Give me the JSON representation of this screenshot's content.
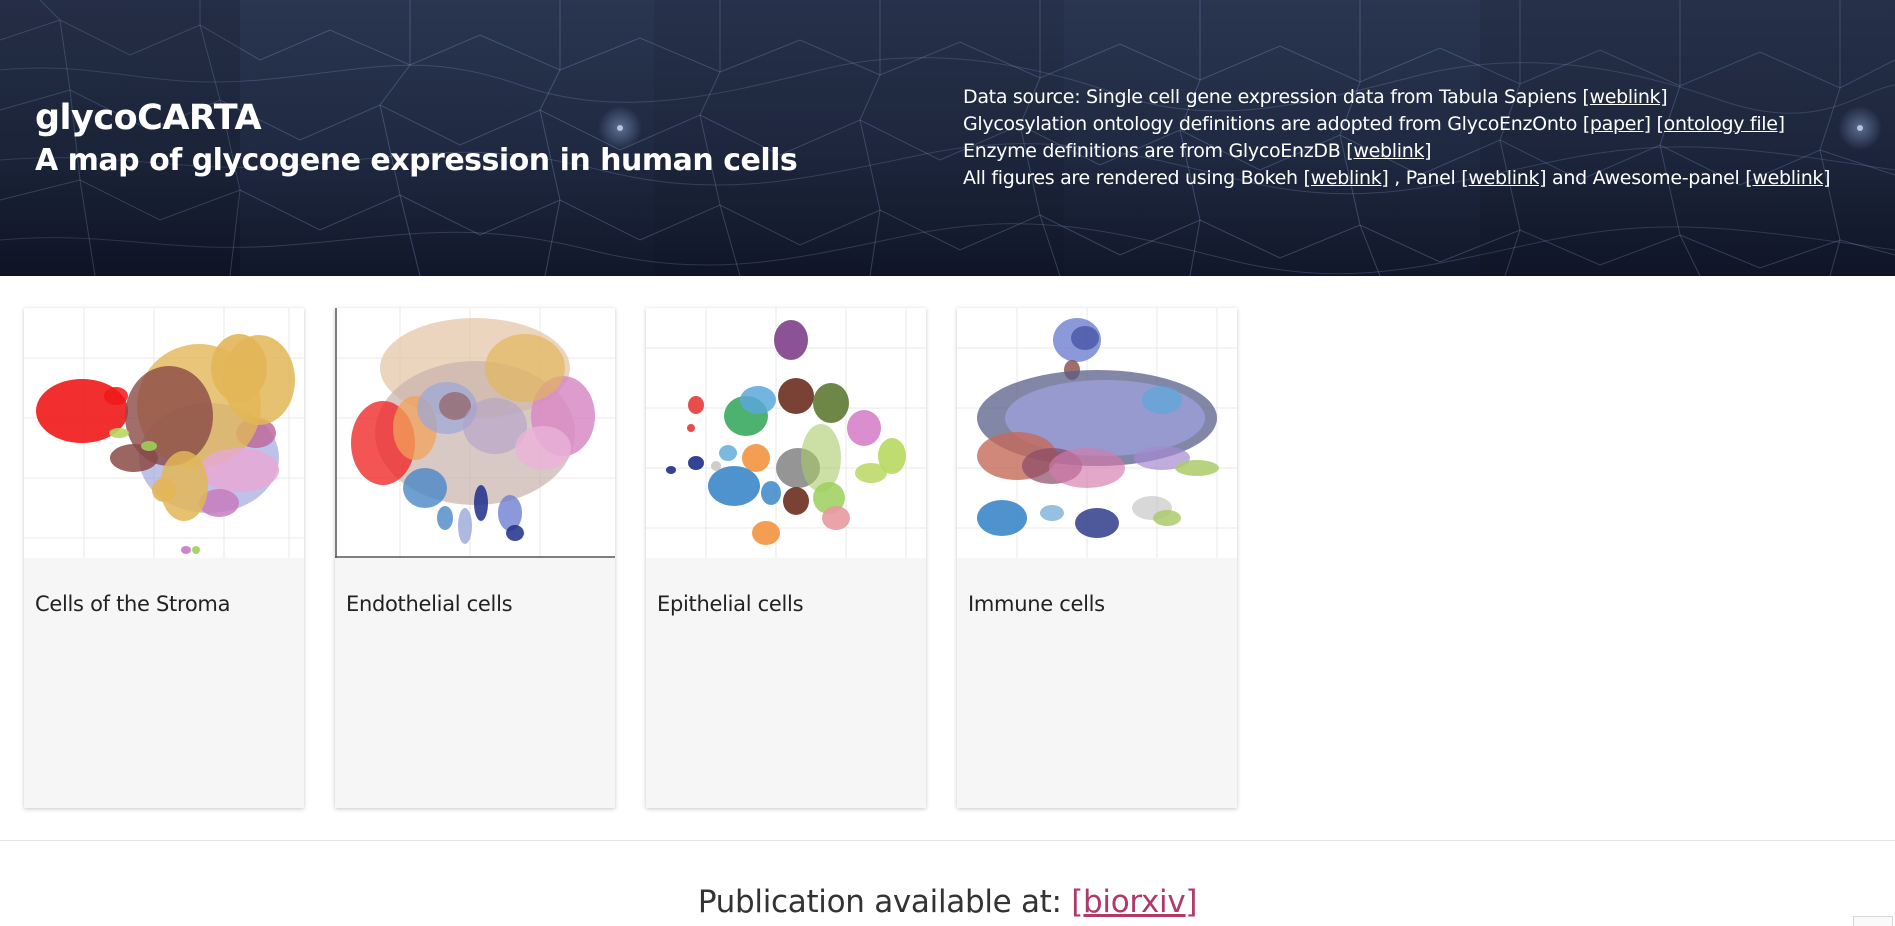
{
  "header": {
    "title": "glycoCARTA",
    "subtitle": "A map of glycogene expression in human cells",
    "sources": {
      "line1": {
        "text": "Data source: Single cell gene expression data from Tabula Sapiens ",
        "link": "[weblink]"
      },
      "line2": {
        "text": "Glycosylation ontology definitions are adopted from GlycoEnzOnto ",
        "link1": "[paper]",
        "link2": "[ontology file]"
      },
      "line3": {
        "text": "Enzyme definitions are from GlycoEnzDB ",
        "link": "[weblink]"
      },
      "line4": {
        "text_a": "All figures are rendered using Bokeh ",
        "link_a": "[weblink]",
        "text_b": " , Panel ",
        "link_b": "[weblink]",
        "text_c": " and Awesome-panel ",
        "link_c": "[weblink]"
      }
    }
  },
  "cards": [
    {
      "label": "Cells of the Stroma"
    },
    {
      "label": "Endothelial cells"
    },
    {
      "label": "Epithelial cells"
    },
    {
      "label": "Immune cells"
    }
  ],
  "footer": {
    "publication_text": "Publication available at: ",
    "publication_link": "[biorxiv]"
  },
  "colors": {
    "banner": "#1c2538",
    "link_footer": "#b0386b",
    "card_bg": "#f6f6f6"
  }
}
